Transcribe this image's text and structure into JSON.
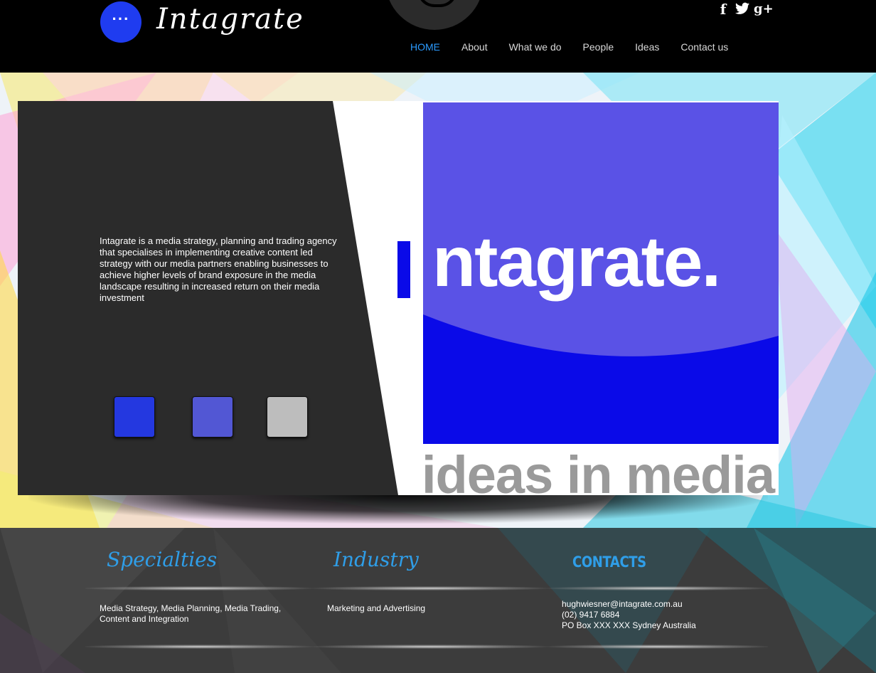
{
  "header": {
    "menu_label": "···",
    "site_title": "Intagrate",
    "social": {
      "facebook_glyph": "f",
      "twitter_glyph": "t",
      "googleplus_glyph": "g+"
    },
    "nav": [
      {
        "label": "HOME",
        "active": true
      },
      {
        "label": "About",
        "active": false
      },
      {
        "label": "What we do",
        "active": false
      },
      {
        "label": "People",
        "active": false
      },
      {
        "label": "Ideas",
        "active": false
      },
      {
        "label": "Contact us",
        "active": false
      }
    ]
  },
  "slide": {
    "description": "   Intagrate is a media strategy, planning and trading agency that specialises in implementing creative content led strategy with our media partners enabling businesses to achieve higher levels of brand exposure in the media landscape resulting in increased return on their media investment",
    "logo_word": "ntagrate.",
    "logo_tagline": "ideas in media",
    "swatch_colors": [
      "#2438e0",
      "#5257d4",
      "#bdbdbd"
    ]
  },
  "footer": {
    "specialties_heading": "Specialties",
    "specialties_text": "Media Strategy, Media Planning, Media Trading, Content and Integration",
    "industry_heading": "Industry",
    "industry_text": "Marketing and Advertising",
    "contacts_heading": "CONTACTS",
    "contact_email": "hughwiesner@intagrate.com.au",
    "contact_phone": "(02) 9417 6884",
    "contact_address": "PO Box XXX XXX Sydney Australia"
  },
  "colors": {
    "accent_blue": "#1f3cf0",
    "nav_active": "#2b9bff",
    "heading_blue": "#2f9ee8",
    "logo_blue": "#0a0ae8",
    "logo_purple": "#5a52e6"
  },
  "icons": [
    "menu-dots-icon",
    "facebook-icon",
    "twitter-icon",
    "google-plus-icon"
  ]
}
